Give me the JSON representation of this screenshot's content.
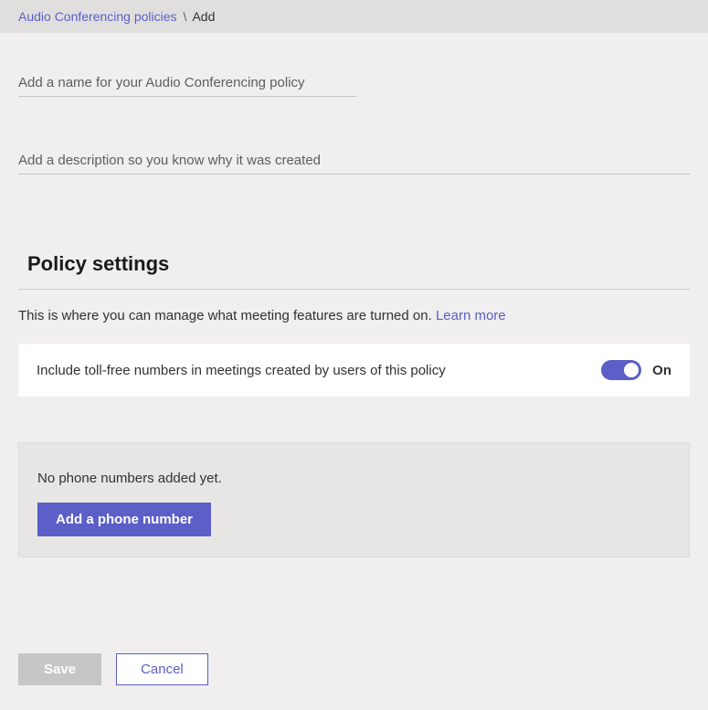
{
  "breadcrumb": {
    "parent": "Audio Conferencing policies",
    "separator": "\\",
    "current": "Add"
  },
  "form": {
    "name_placeholder": "Add a name for your Audio Conferencing policy",
    "description_placeholder": "Add a description so you know why it was created"
  },
  "settings": {
    "heading": "Policy settings",
    "description": "This is where you can manage what meeting features are turned on.",
    "learn_more": "Learn more",
    "toggle": {
      "label": "Include toll-free numbers in meetings created by users of this policy",
      "state": "On"
    }
  },
  "phone": {
    "empty_text": "No phone numbers added yet.",
    "add_button": "Add a phone number"
  },
  "footer": {
    "save": "Save",
    "cancel": "Cancel"
  }
}
